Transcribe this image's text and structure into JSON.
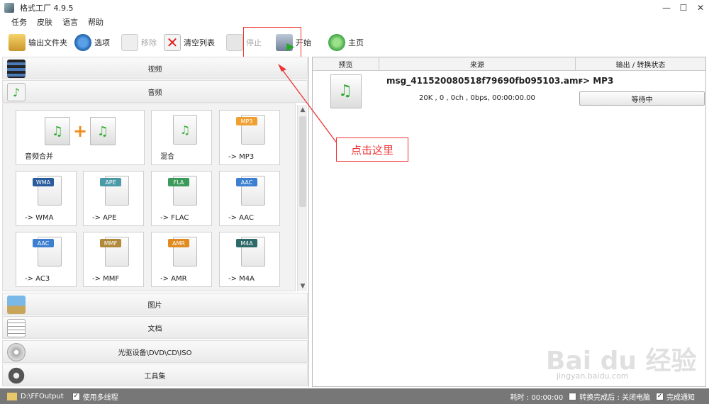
{
  "window": {
    "title": "格式工厂 4.9.5",
    "min": "—",
    "max": "☐",
    "close": "✕"
  },
  "menu": [
    "任务",
    "皮肤",
    "语言",
    "帮助"
  ],
  "toolbar": {
    "output_folder": "输出文件夹",
    "options": "选项",
    "remove": "移除",
    "clear_list": "清空列表",
    "stop": "停止",
    "start": "开始",
    "home": "主页"
  },
  "categories": {
    "video": "视频",
    "audio": "音频",
    "picture": "图片",
    "document": "文档",
    "optical": "光驱设备\\DVD\\CD\\ISO",
    "tools": "工具集"
  },
  "tiles": [
    {
      "label": "音频合并",
      "tag": ""
    },
    {
      "label": "混合",
      "tag": ""
    },
    {
      "label": "-> MP3",
      "tag": "MP3"
    },
    {
      "label": "-> WMA",
      "tag": "WMA"
    },
    {
      "label": "-> APE",
      "tag": "APE"
    },
    {
      "label": "-> FLAC",
      "tag": "FLA"
    },
    {
      "label": "-> AAC",
      "tag": "AAC"
    },
    {
      "label": "-> AC3",
      "tag": "AAC"
    },
    {
      "label": "-> MMF",
      "tag": "MMF"
    },
    {
      "label": "-> AMR",
      "tag": "AMR"
    },
    {
      "label": "-> M4A",
      "tag": "M4A"
    }
  ],
  "table": {
    "headers": {
      "preview": "预览",
      "source": "来源",
      "output": "输出 / 转换状态"
    },
    "row": {
      "filename": "msg_411520080518f79690fb095103.amr",
      "info": "20K , 0 , 0ch , 0bps, 00:00:00.00",
      "output_format": "-> MP3",
      "status": "等待中"
    }
  },
  "annotation": "点击这里",
  "statusbar": {
    "output_path": "D:\\FFOutput",
    "multithread": "使用多线程",
    "elapsed": "耗时 : 00:00:00",
    "after_done": "转换完成后 : 关闭电脑",
    "notify": "完成通知",
    "check": "✓"
  },
  "watermark": {
    "logo": "Bai du 经验",
    "url": "jingyan.baidu.com"
  },
  "colors": {
    "accent_red": "#e33",
    "statusbar": "#777"
  }
}
